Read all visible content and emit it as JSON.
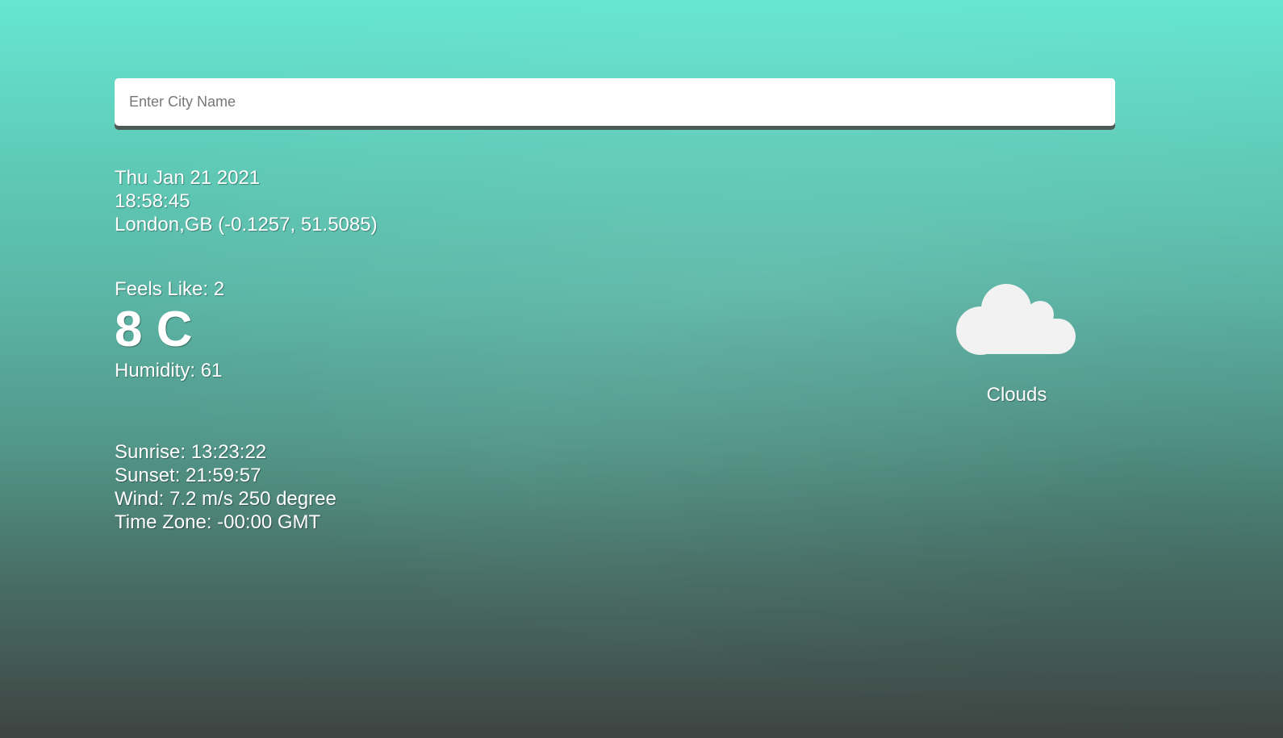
{
  "search": {
    "placeholder": "Enter City Name",
    "value": ""
  },
  "info": {
    "date": "Thu Jan 21 2021",
    "time": "18:58:45",
    "location": "London,GB (-0.1257, 51.5085)",
    "feels_like": "Feels Like: 2",
    "temperature": "8 C",
    "humidity": "Humidity: 61",
    "sunrise": "Sunrise: 13:23:22",
    "sunset": "Sunset: 21:59:57",
    "wind": "Wind: 7.2 m/s 250 degree",
    "timezone": "Time Zone: -00:00 GMT"
  },
  "weather": {
    "icon": "cloud-icon",
    "description": "Clouds"
  }
}
